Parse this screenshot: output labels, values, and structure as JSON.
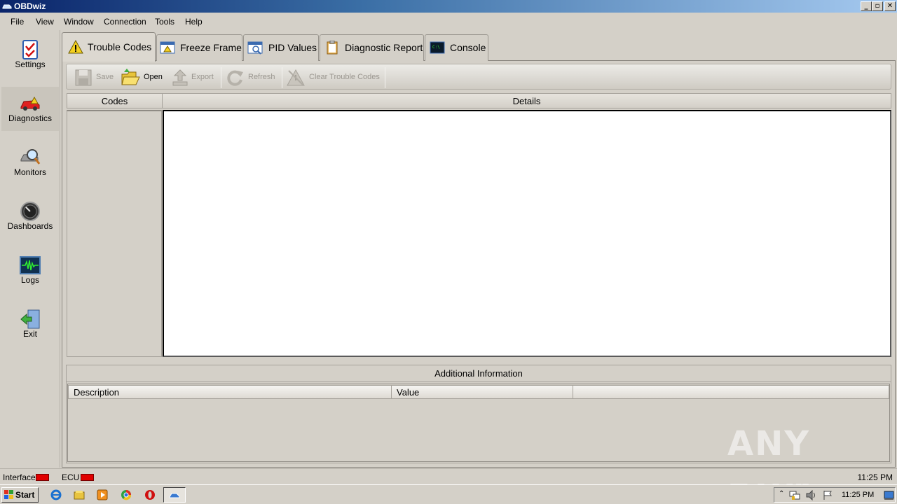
{
  "window": {
    "title": "OBDwiz",
    "minimize": "_",
    "restore": "▫",
    "close": "✕"
  },
  "menu": [
    "File",
    "View",
    "Window",
    "Connection",
    "Tools",
    "Help"
  ],
  "sidebar": [
    {
      "label": "Settings",
      "icon": "settings-icon"
    },
    {
      "label": "Diagnostics",
      "icon": "car-icon"
    },
    {
      "label": "Monitors",
      "icon": "monitor-magnifier-icon"
    },
    {
      "label": "Dashboards",
      "icon": "gauge-icon"
    },
    {
      "label": "Logs",
      "icon": "waveform-icon"
    },
    {
      "label": "Exit",
      "icon": "exit-door-icon"
    }
  ],
  "tabs": [
    {
      "label": "Trouble Codes",
      "icon": "warning-icon",
      "active": true
    },
    {
      "label": "Freeze Frame",
      "icon": "freeze-frame-icon"
    },
    {
      "label": "PID Values",
      "icon": "pid-values-icon"
    },
    {
      "label": "Diagnostic Report",
      "icon": "clipboard-icon"
    },
    {
      "label": "Console",
      "icon": "console-icon"
    }
  ],
  "toolbar": {
    "save": "Save",
    "open": "Open",
    "export": "Export",
    "refresh": "Refresh",
    "clear": "Clear Trouble Codes"
  },
  "codes_header": "Codes",
  "details_header": "Details",
  "additional": {
    "title": "Additional Information",
    "columns": [
      "Description",
      "Value"
    ]
  },
  "status": {
    "interface_label": "Interface",
    "ecu_label": "ECU",
    "time": "11:25 PM",
    "led_color": "#e00000"
  },
  "taskbar": {
    "start": "Start",
    "time": "11:25 PM"
  },
  "watermark": "ANY RUN"
}
